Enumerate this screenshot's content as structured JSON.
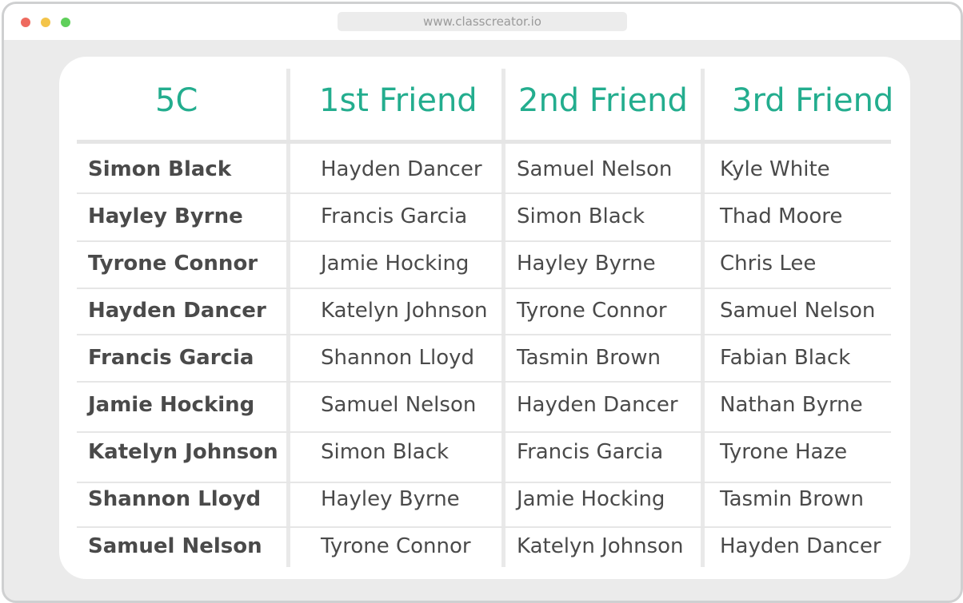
{
  "browser": {
    "url": "www.classcreator.io"
  },
  "table": {
    "headers": [
      "5C",
      "1st Friend",
      "2nd Friend",
      "3rd Friend"
    ],
    "rows": [
      [
        "Simon Black",
        "Hayden Dancer",
        "Samuel Nelson",
        "Kyle White"
      ],
      [
        "Hayley Byrne",
        "Francis Garcia",
        "Simon Black",
        "Thad Moore"
      ],
      [
        "Tyrone Connor",
        "Jamie Hocking",
        "Hayley Byrne",
        "Chris Lee"
      ],
      [
        "Hayden Dancer",
        "Katelyn Johnson",
        "Tyrone Connor",
        "Samuel Nelson"
      ],
      [
        "Francis Garcia",
        "Shannon Lloyd",
        "Tasmin Brown",
        "Fabian Black"
      ],
      [
        "Jamie Hocking",
        "Samuel Nelson",
        "Hayden Dancer",
        "Nathan Byrne"
      ],
      [
        "Katelyn Johnson",
        "Simon Black",
        "Francis Garcia",
        "Tyrone Haze"
      ],
      [
        "Shannon Lloyd",
        "Hayley Byrne",
        "Jamie Hocking",
        "Tasmin Brown"
      ],
      [
        "Samuel Nelson",
        "Tyrone Connor",
        "Katelyn Johnson",
        "Hayden Dancer"
      ]
    ]
  },
  "colors": {
    "accent": "#23ad8e",
    "text": "#4a4a4a"
  }
}
